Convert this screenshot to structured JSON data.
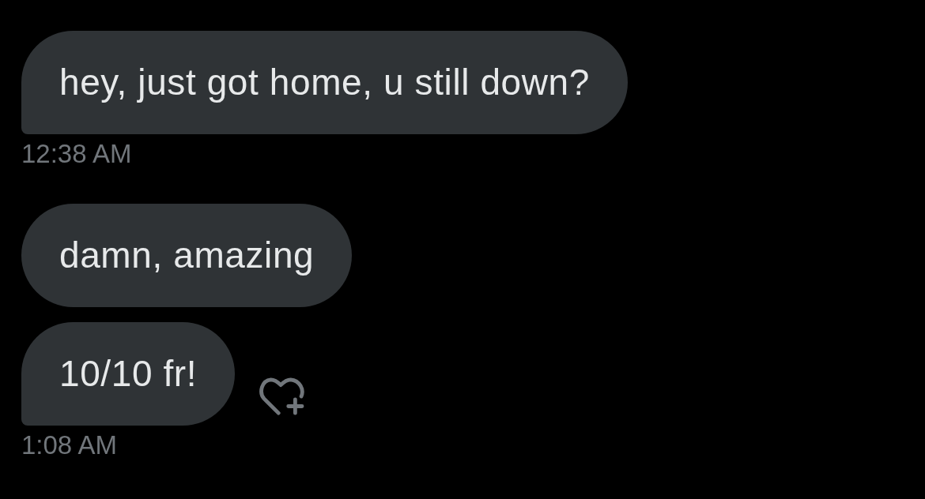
{
  "groups": [
    {
      "bubbles": [
        {
          "text": "hey, just got home, u still down?"
        }
      ],
      "time": "12:38 AM"
    },
    {
      "bubbles": [
        {
          "text": "damn, amazing"
        },
        {
          "text": "10/10 fr!"
        }
      ],
      "time": "1:08 AM"
    }
  ]
}
